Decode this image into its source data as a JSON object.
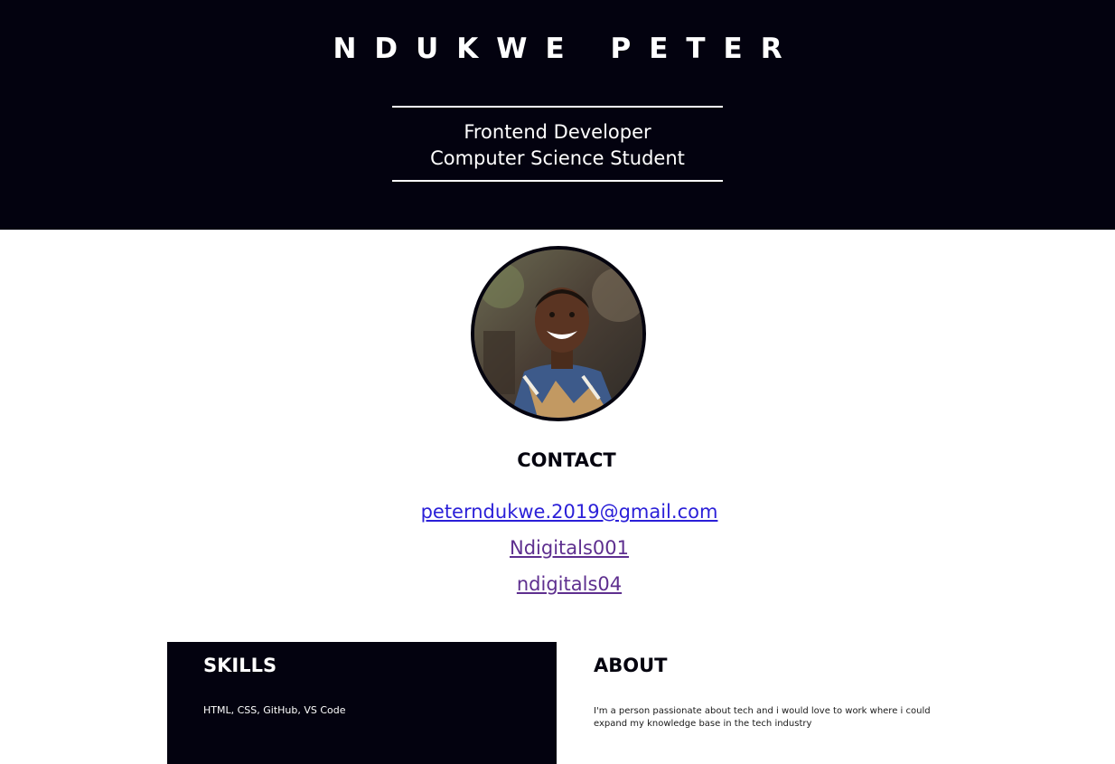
{
  "header": {
    "name": "NDUKWE PETER",
    "subtitle_line1": "Frontend Developer",
    "subtitle_line2": "Computer Science Student"
  },
  "profile": {
    "photo_alt": "profile-photo"
  },
  "contact": {
    "title": "CONTACT",
    "email": "peterndukwe.2019@gmail.com",
    "link2": "Ndigitals001",
    "link3": "ndigitals04"
  },
  "skills": {
    "title": "SKILLS",
    "text": "HTML, CSS, GitHub, VS Code"
  },
  "about": {
    "title": "ABOUT",
    "text": "I'm a person passionate about tech and i would love to work where i could expand my knowledge base in the tech industry"
  },
  "colors": {
    "header_bg": "#03020f",
    "link_unvisited": "#2a1fd8",
    "link_visited": "#5e2f8f"
  }
}
